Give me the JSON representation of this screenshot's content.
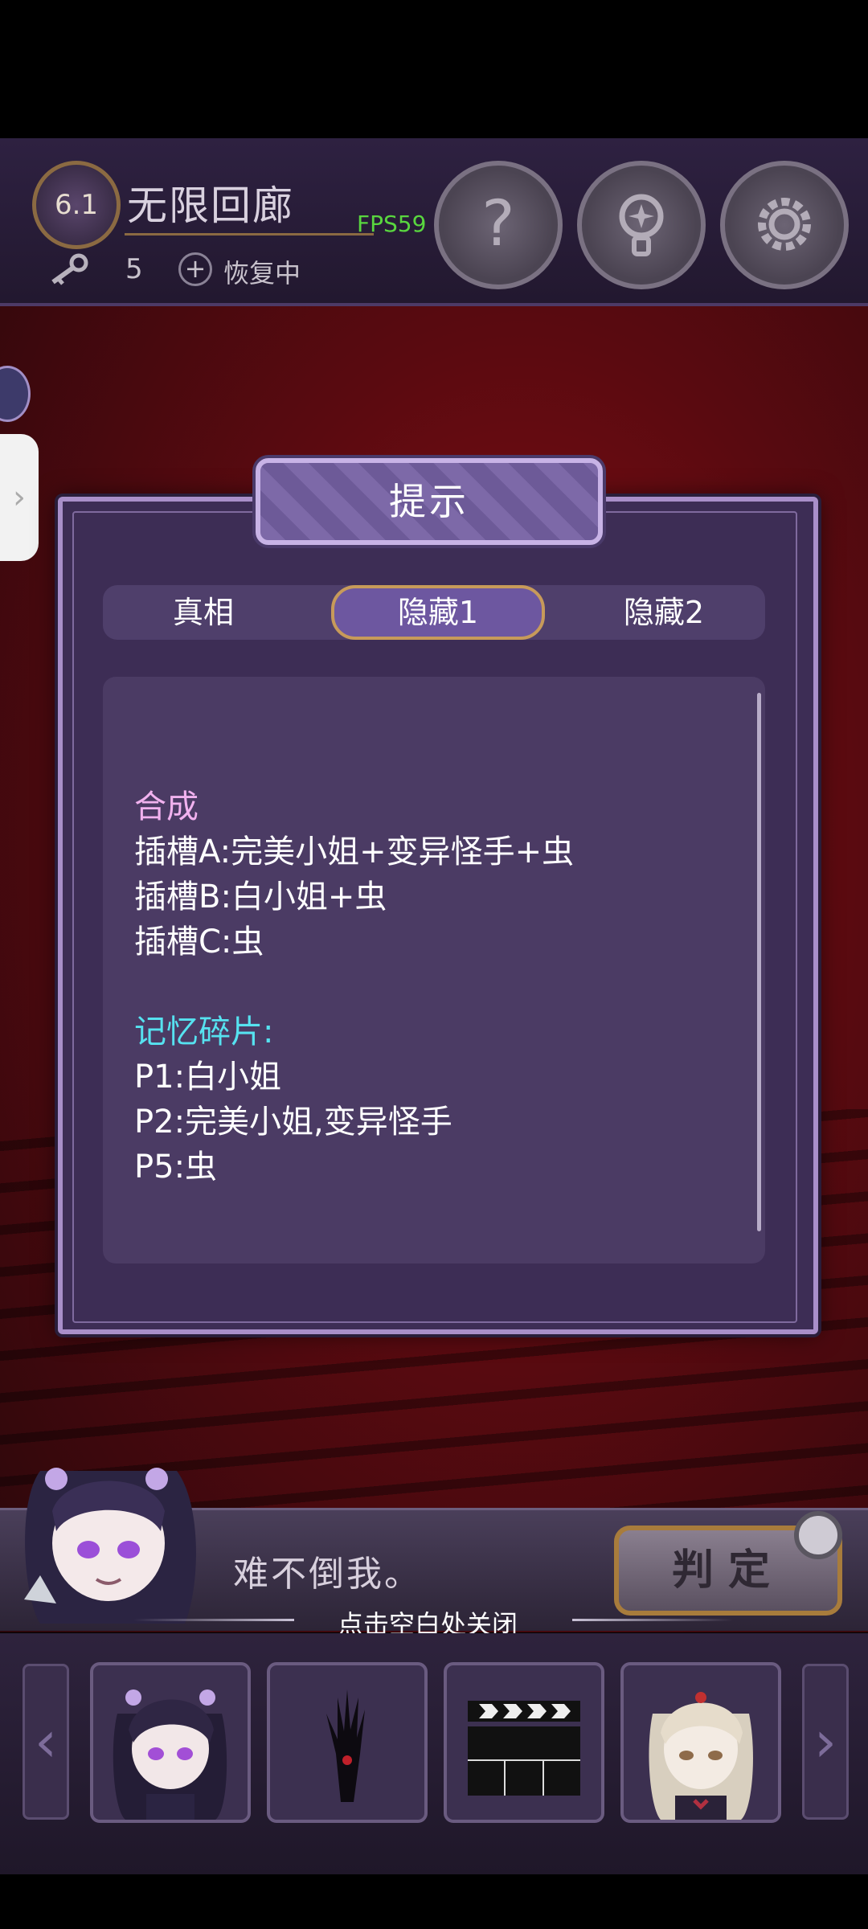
{
  "header": {
    "level": "6.1",
    "level_title": "无限回廊",
    "fps": "FPS59",
    "keys": "5",
    "add": "+",
    "recover_status": "恢复中",
    "icons": [
      "key-icon",
      "help-icon",
      "hint-icon",
      "settings-icon"
    ]
  },
  "dialog": {
    "title": "提示",
    "tabs": [
      {
        "label": "真相",
        "selected": false
      },
      {
        "label": "隐藏1",
        "selected": true
      },
      {
        "label": "隐藏2",
        "selected": false
      }
    ],
    "content": {
      "section1_title": "合成",
      "section1_lines": [
        "插槽A:完美小姐+变异怪手+虫",
        "插槽B:白小姐+虫",
        "插槽C:虫"
      ],
      "section2_title": "记忆碎片:",
      "section2_lines": [
        "P1:白小姐",
        "P2:完美小姐,变异怪手",
        "P5:虫"
      ]
    }
  },
  "dialogue": {
    "text": "难不倒我。",
    "judge_label": "判定",
    "close_hint": "点击空白处关闭"
  },
  "inventory": {
    "prev": "‹",
    "next": "›",
    "items": [
      "girl-with-twin-tails",
      "black-hand",
      "clapperboard",
      "blonde-girl"
    ]
  },
  "colors": {
    "section1_title": "#f1b2ef",
    "section2_title": "#56e2f0",
    "fps": "#59d63f",
    "selected_tab_border": "#c79a5a"
  }
}
